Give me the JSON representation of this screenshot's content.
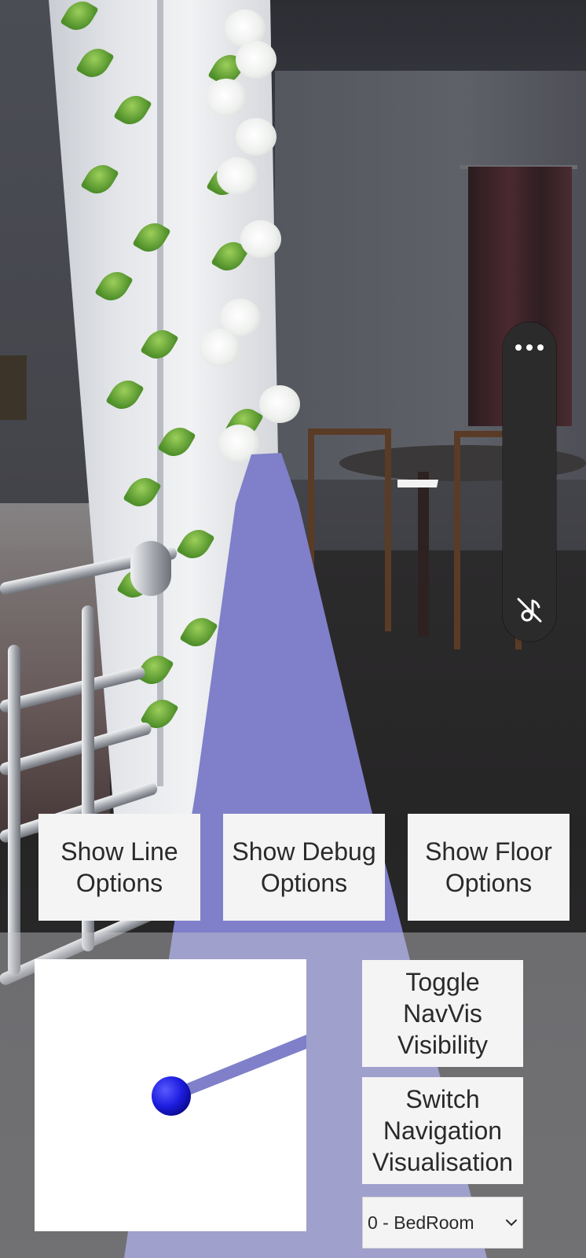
{
  "buttons": {
    "show_line_options": "Show Line\nOptions",
    "show_debug_options": "Show Debug\nOptions",
    "show_floor_options": "Show Floor\nOptions",
    "toggle_navvis_visibility": "Toggle\nNavVis\nVisibility",
    "switch_navigation_visualisation": "Switch\nNavigation\nVisualisation"
  },
  "floor_select": {
    "selected": "0 - BedRoom",
    "options": [
      "0 - BedRoom"
    ]
  },
  "side_toolbar": {
    "more_icon": "more-horizontal-icon",
    "mute_icon": "music-off-icon"
  },
  "colors": {
    "nav_path": "#7f80c9",
    "minimap_marker": "#1d1de0",
    "button_bg": "#f4f4f4",
    "button_text": "#2a2a2a",
    "toolbar_bg": "#2b2b2b"
  }
}
